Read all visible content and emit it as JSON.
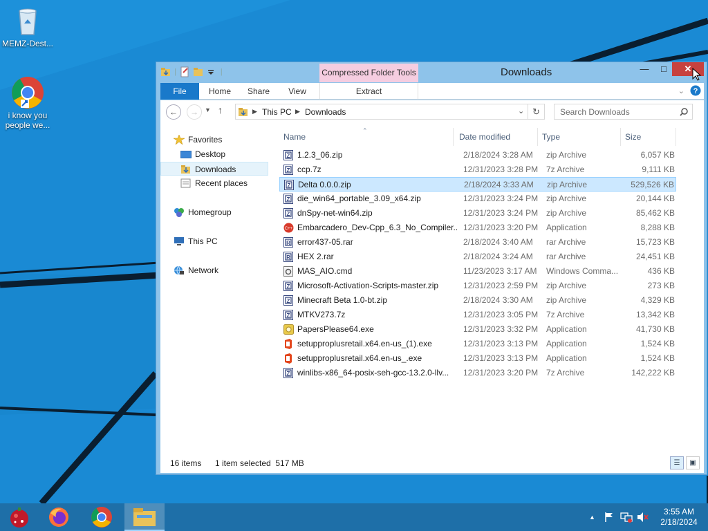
{
  "desktop": {
    "icons": [
      {
        "label": "MEMZ-Dest...",
        "icon": "recycle-bin-icon"
      },
      {
        "label": "i know you people we...",
        "icon": "chrome-shortcut-icon"
      }
    ]
  },
  "window": {
    "title": "Downloads",
    "contextual_tab_group": "Compressed Folder Tools",
    "ribbon_tabs": {
      "file": "File",
      "home": "Home",
      "share": "Share",
      "view": "View",
      "extract": "Extract"
    },
    "address": {
      "crumb1": "This PC",
      "crumb2": "Downloads"
    },
    "search_placeholder": "Search Downloads",
    "nav_pane": {
      "favorites": "Favorites",
      "desktop": "Desktop",
      "downloads": "Downloads",
      "recent": "Recent places",
      "homegroup": "Homegroup",
      "this_pc": "This PC",
      "network": "Network"
    },
    "columns": {
      "name": "Name",
      "date": "Date modified",
      "type": "Type",
      "size": "Size"
    },
    "files": [
      {
        "name": "1.2.3_06.zip",
        "date": "2/18/2024 3:28 AM",
        "type": "zip Archive",
        "size": "6,057 KB",
        "icon": "zip"
      },
      {
        "name": "ccp.7z",
        "date": "12/31/2023 3:28 PM",
        "type": "7z Archive",
        "size": "9,111 KB",
        "icon": "zip"
      },
      {
        "name": "Delta 0.0.0.zip",
        "date": "2/18/2024 3:33 AM",
        "type": "zip Archive",
        "size": "529,526 KB",
        "icon": "zip"
      },
      {
        "name": "die_win64_portable_3.09_x64.zip",
        "date": "12/31/2023 3:24 PM",
        "type": "zip Archive",
        "size": "20,144 KB",
        "icon": "zip"
      },
      {
        "name": "dnSpy-net-win64.zip",
        "date": "12/31/2023 3:24 PM",
        "type": "zip Archive",
        "size": "85,462 KB",
        "icon": "zip"
      },
      {
        "name": "Embarcadero_Dev-Cpp_6.3_No_Compiler...",
        "date": "12/31/2023 3:20 PM",
        "type": "Application",
        "size": "8,288 KB",
        "icon": "devcpp"
      },
      {
        "name": "error437-05.rar",
        "date": "2/18/2024 3:40 AM",
        "type": "rar Archive",
        "size": "15,723 KB",
        "icon": "rar"
      },
      {
        "name": "HEX 2.rar",
        "date": "2/18/2024 3:24 AM",
        "type": "rar Archive",
        "size": "24,451 KB",
        "icon": "rar"
      },
      {
        "name": "MAS_AIO.cmd",
        "date": "11/23/2023 3:17 AM",
        "type": "Windows Comma...",
        "size": "436 KB",
        "icon": "cmd"
      },
      {
        "name": "Microsoft-Activation-Scripts-master.zip",
        "date": "12/31/2023 2:59 PM",
        "type": "zip Archive",
        "size": "273 KB",
        "icon": "zip"
      },
      {
        "name": "Minecraft Beta 1.0-bt.zip",
        "date": "2/18/2024 3:30 AM",
        "type": "zip Archive",
        "size": "4,329 KB",
        "icon": "zip"
      },
      {
        "name": "MTKV273.7z",
        "date": "12/31/2023 3:05 PM",
        "type": "7z Archive",
        "size": "13,342 KB",
        "icon": "zip"
      },
      {
        "name": "PapersPlease64.exe",
        "date": "12/31/2023 3:32 PM",
        "type": "Application",
        "size": "41,730 KB",
        "icon": "papers"
      },
      {
        "name": "setupproplusretail.x64.en-us_(1).exe",
        "date": "12/31/2023 3:13 PM",
        "type": "Application",
        "size": "1,524 KB",
        "icon": "office"
      },
      {
        "name": "setupproplusretail.x64.en-us_.exe",
        "date": "12/31/2023 3:13 PM",
        "type": "Application",
        "size": "1,524 KB",
        "icon": "office"
      },
      {
        "name": "winlibs-x86_64-posix-seh-gcc-13.2.0-llv...",
        "date": "12/31/2023 3:20 PM",
        "type": "7z Archive",
        "size": "142,222 KB",
        "icon": "zip"
      }
    ],
    "selected_index": 2,
    "status": {
      "count": "16 items",
      "selection": "1 item selected  517 MB"
    }
  },
  "taskbar": {
    "clock_time": "3:55 AM",
    "clock_date": "2/18/2024"
  }
}
